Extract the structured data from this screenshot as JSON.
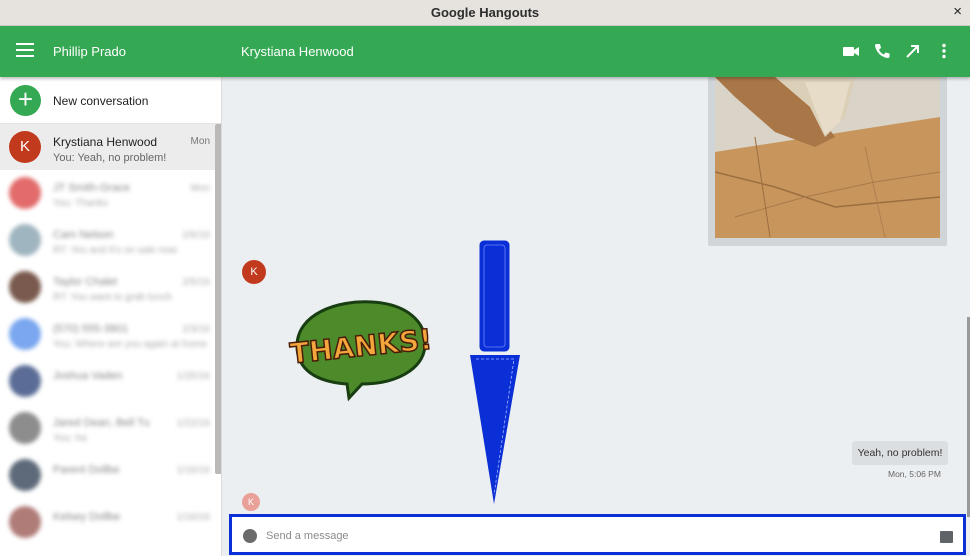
{
  "window": {
    "title": "Google Hangouts",
    "close_label": "×"
  },
  "appbar": {
    "user_name": "Phillip Prado",
    "contact_name": "Krystiana Henwood",
    "actions": [
      "video-call-icon",
      "phone-icon",
      "pop-out-icon",
      "more-vert-icon"
    ],
    "color": "#34a853"
  },
  "sidebar": {
    "new_conversation_label": "New conversation",
    "new_conversation_icon": "+",
    "active_conversation": {
      "initial": "K",
      "name": "Krystiana Henwood",
      "time": "Mon",
      "preview": "You: Yeah, no problem!"
    },
    "blurred_conversations": [
      {
        "name": "JT Smith-Grace",
        "time": "Mon",
        "preview": "You: Thanks",
        "color": "#e36b6b"
      },
      {
        "name": "Cam Nelson",
        "time": "2/6/16",
        "preview": "RT: Yes and it's on sale now",
        "color": "#9fb5c0"
      },
      {
        "name": "Taylor Chalet",
        "time": "2/5/16",
        "preview": "RT: You want to grab lunch",
        "color": "#7a5a4e"
      },
      {
        "name": "(570) 555-3801",
        "time": "2/3/16",
        "preview": "You: Where are you again at home",
        "color": "#7aa7f0"
      },
      {
        "name": "Joshua Vaden",
        "time": "1/25/16",
        "preview": "",
        "color": "#5b6d96"
      },
      {
        "name": "Jared Dean, Bell Tu",
        "time": "1/22/16",
        "preview": "You: ha",
        "color": "#8d8d8d"
      },
      {
        "name": "Parent Dollbe",
        "time": "1/16/16",
        "preview": "",
        "color": "#5e6a7a"
      },
      {
        "name": "Kelsey Dollbe",
        "time": "1/16/16",
        "preview": "",
        "color": "#b07c78"
      }
    ]
  },
  "chat": {
    "sender_initial": "K",
    "sticker_text": "THANKS!",
    "message_text": "Yeah, no problem!",
    "message_time": "Mon, 5:06 PM",
    "composer_placeholder": "Send a message",
    "annotation_color": "#0a2fd6"
  }
}
